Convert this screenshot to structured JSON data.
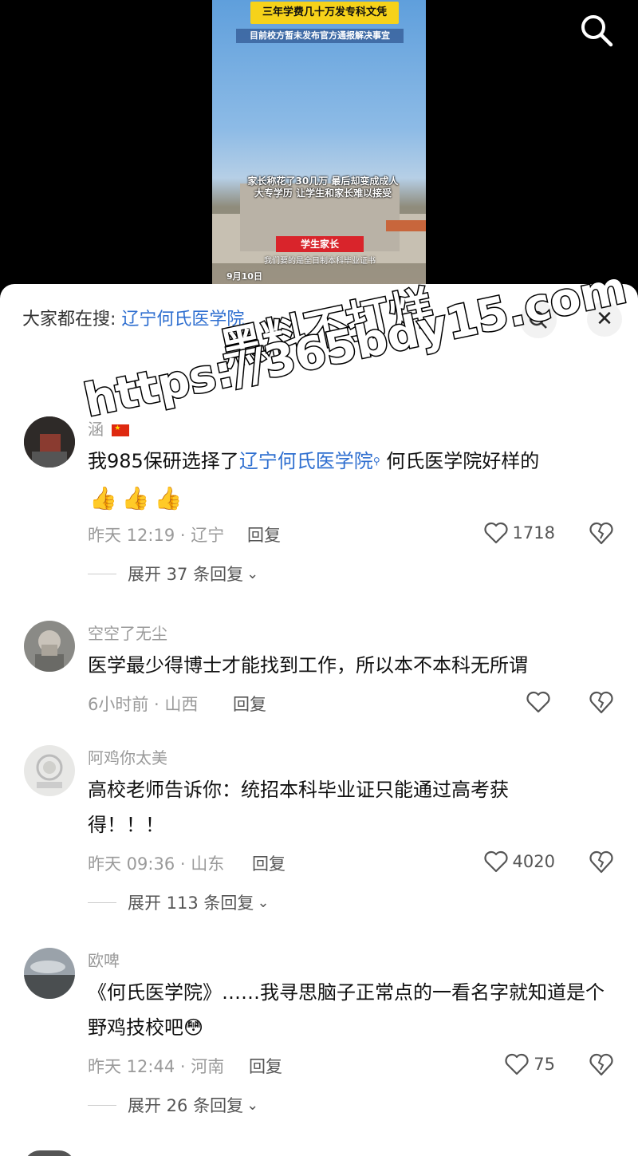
{
  "video": {
    "banner_title": "三年学费几十万发专科文凭",
    "banner_sub": "目前校方暂未发布官方通报解决事宜",
    "caption": "家长称花了30几万 最后却变成成人大专学历 让学生和家长难以接受",
    "speaker_tag": "学生家长",
    "subtitle": "我们要的是全日制本科毕业证书",
    "date": "9月10日"
  },
  "search": {
    "prefix": "大家都在搜:",
    "term": "辽宁何氏医学院"
  },
  "watermark": {
    "line1": "黑料不打烊",
    "line2": "https://365bdy15.com"
  },
  "comments": [
    {
      "user": "涵",
      "text_before": "我985保研选择了",
      "link": "辽宁何氏医学院",
      "text_after": "何氏医学院好样的",
      "emoji": [
        "👍",
        "👍",
        "👍"
      ],
      "time_loc": "昨天 12:19 · 辽宁",
      "reply": "回复",
      "likes": "1718",
      "expand": "展开 37 条回复"
    },
    {
      "user": "空空了无尘",
      "text": "医学最少得博士才能找到工作，所以本不本科无所谓",
      "time_loc": "6小时前 · 山西",
      "reply": "回复",
      "likes": ""
    },
    {
      "user": "阿鸡你太美",
      "text": "高校老师告诉你：统招本科毕业证只能通过高考获得！！！",
      "time_loc": "昨天 09:36 · 山东",
      "reply": "回复",
      "likes": "4020",
      "expand": "展开 113 条回复"
    },
    {
      "user": "欧啤",
      "text": "《何氏医学院》……我寻思脑子正常点的一看名字就知道是个野鸡技校吧😳",
      "time_loc": "昨天 12:44 · 河南",
      "reply": "回复",
      "likes": "75",
      "expand": "展开 26 条回复"
    }
  ],
  "colors": {
    "link": "#2f6fd0",
    "meta": "#9a9a9a",
    "text": "#111111"
  }
}
